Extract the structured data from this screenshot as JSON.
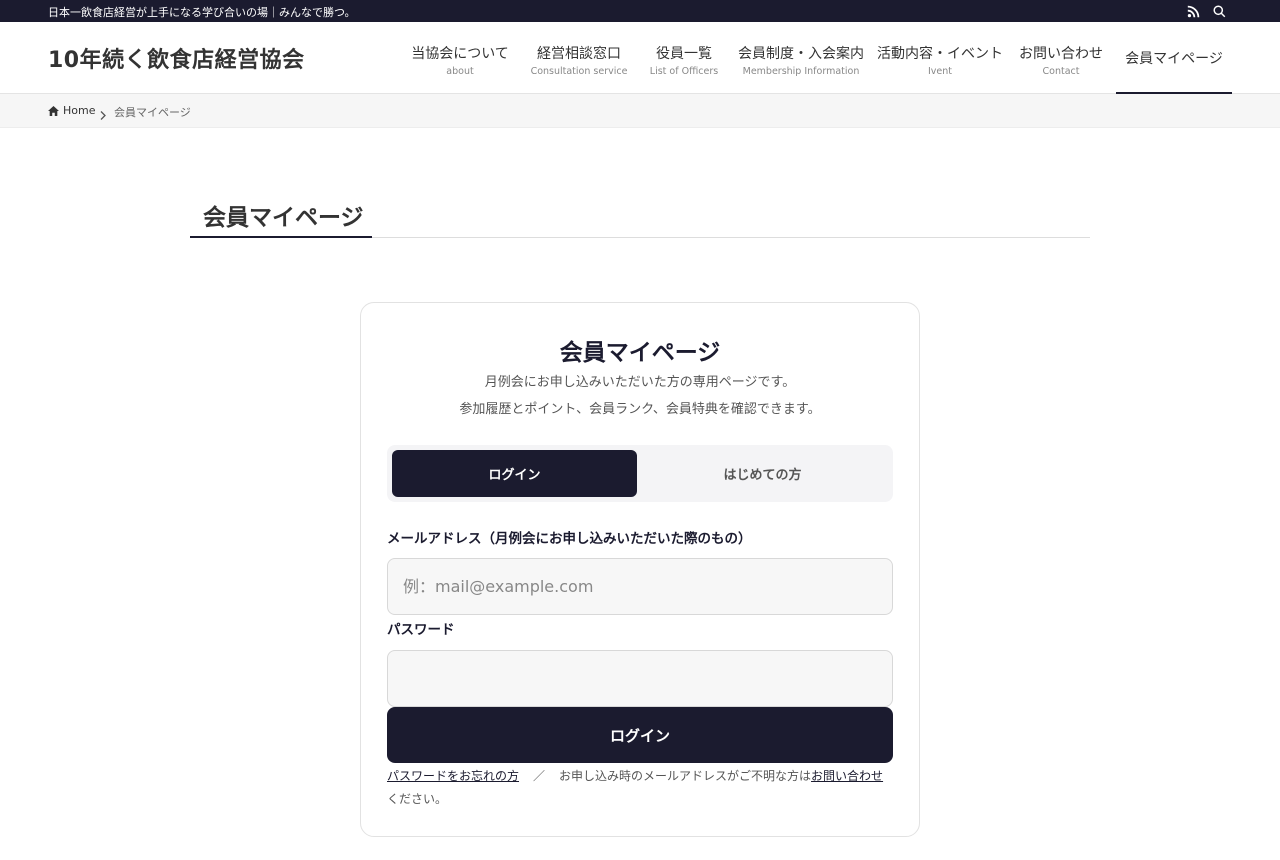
{
  "topbar": {
    "tagline": "日本一飲食店経営が上手になる学び合いの場｜みんなで勝つ。",
    "icons": [
      "rss-icon",
      "search-icon"
    ]
  },
  "header": {
    "site_title": "10年続く飲食店経営協会",
    "nav": [
      {
        "label": "当協会について",
        "sub": "about"
      },
      {
        "label": "経営相談窓口",
        "sub": "Consultation service"
      },
      {
        "label": "役員一覧",
        "sub": "List of Officers"
      },
      {
        "label": "会員制度・入会案内",
        "sub": "Membership Information"
      },
      {
        "label": "活動内容・イベント",
        "sub": "Ivent"
      },
      {
        "label": "お問い合わせ",
        "sub": "Contact"
      },
      {
        "label": "会員マイページ",
        "sub": ""
      }
    ],
    "active_index": 6
  },
  "breadcrumb": {
    "home": "Home",
    "current": "会員マイページ"
  },
  "page": {
    "title": "会員マイページ"
  },
  "card": {
    "title": "会員マイページ",
    "desc_line1": "月例会にお申し込みいただいた方の専用ページです。",
    "desc_line2": "参加履歴とポイント、会員ランク、会員特典を確認できます。",
    "tabs": {
      "login": "ログイン",
      "first": "はじめての方"
    },
    "email_label": "メールアドレス（月例会にお申し込みいただいた際のもの）",
    "email_placeholder": "例：mail@example.com",
    "email_value": "",
    "password_label": "パスワード",
    "password_value": "",
    "submit_label": "ログイン",
    "forgot_link": "パスワードをお忘れの方",
    "slash": "／",
    "help_text": "お申し込み時のメールアドレスがご不明な方は",
    "contact_link": "お問い合わせ",
    "help_suffix": "ください。"
  },
  "colors": {
    "primary": "#1b1b2f",
    "breadcrumb_bg": "#f6f6f6",
    "input_bg": "#f7f7f7"
  }
}
